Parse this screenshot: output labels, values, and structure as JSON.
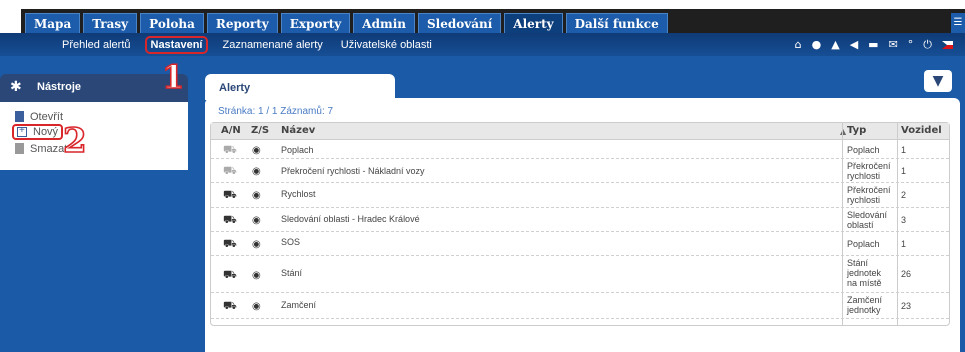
{
  "top_tabs": [
    "Mapa",
    "Trasy",
    "Poloha",
    "Reporty",
    "Exporty",
    "Admin",
    "Sledování",
    "Alerty",
    "Další funkce"
  ],
  "active_tab": "Alerty",
  "sub_nav": [
    "Přehled alertů",
    "Nastavení",
    "Zaznamenané alerty",
    "Uživatelské oblasti"
  ],
  "active_sub": "Nastavení",
  "left_panel": {
    "title": "Nástroje",
    "tools": [
      "Otevřít",
      "Nový",
      "Smazat"
    ]
  },
  "annotations": [
    "1",
    "2"
  ],
  "main": {
    "tab_title": "Alerty",
    "page_info": "Stránka: 1 / 1  Záznamů: 7",
    "columns": [
      "A/N",
      "Z/S",
      "Název",
      "Typ",
      "Vozidel"
    ],
    "rows": [
      {
        "active": false,
        "name": "Poplach",
        "typ": "Poplach",
        "vozidel": "1"
      },
      {
        "active": false,
        "name": "Překročení rychlosti - Nákladní vozy",
        "typ": "Překročení rychlosti",
        "vozidel": "1"
      },
      {
        "active": true,
        "name": "Rychlost",
        "typ": "Překročení rychlosti",
        "vozidel": "2"
      },
      {
        "active": true,
        "name": "Sledování oblasti - Hradec Králové",
        "typ": "Sledování oblastí",
        "vozidel": "3"
      },
      {
        "active": true,
        "name": "SOS",
        "typ": "Poplach",
        "vozidel": "1"
      },
      {
        "active": true,
        "name": "Stání",
        "typ": "Stání jednotek na místě",
        "vozidel": "26"
      },
      {
        "active": true,
        "name": "Zamčení",
        "typ": "Zamčení jednotky",
        "vozidel": "23"
      }
    ]
  },
  "colors": {
    "background": "#1b5aa6",
    "tab": "#1c5caa",
    "highlight": "#d8262b",
    "panel_header": "#2a4778"
  },
  "icons": [
    "gear-icon",
    "home-icon",
    "chat-icon",
    "warning-icon",
    "sound-icon",
    "folder-icon",
    "mail-icon",
    "settings-icon",
    "power-icon",
    "flag-icon",
    "filter-icon",
    "car-icon",
    "eye-icon"
  ]
}
